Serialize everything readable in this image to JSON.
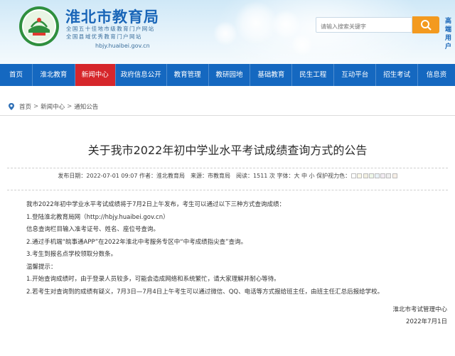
{
  "header": {
    "site_title": "淮北市教育局",
    "sub1": "全国五十佳地市级教育门户网站",
    "sub2": "全国县域优秀教育门户网站",
    "url": "hbjy.huaibei.gov.cn",
    "search_placeholder": "请输入搜索关键字",
    "right_text_1": "高端",
    "right_text_2": "用户"
  },
  "nav": {
    "items": [
      {
        "label": "首页"
      },
      {
        "label": "淮北教育"
      },
      {
        "label": "新闻中心"
      },
      {
        "label": "政府信息公开"
      },
      {
        "label": "教育管理"
      },
      {
        "label": "教研园地"
      },
      {
        "label": "基础教育"
      },
      {
        "label": "民生工程"
      },
      {
        "label": "互动平台"
      },
      {
        "label": "招生考试"
      },
      {
        "label": "信息资"
      }
    ]
  },
  "breadcrumb": {
    "items": [
      "首页",
      "新闻中心",
      "通知公告"
    ],
    "sep": ">"
  },
  "article": {
    "title": "关于我市2022年初中学业水平考试成绩查询方式的公告",
    "meta": "发布日期：2022-07-01 09:07 作者：淮北教育局　来源：市教育局　阅读：1511 次 字体：大 中 小 保护视力色：",
    "paragraphs": [
      "我市2022年初中学业水平考试成绩将于7月2日上午发布，考生可以通过以下三种方式查询成绩：",
      "1.登陆淮北教育局网（http://hbjy.huaibei.gov.cn）",
      "信息查询栏目输入准考证号、姓名、座位号查询。",
      "2.通过手机端“皖事通APP”在2022年淮北中考服务专区中“中考成绩指尖查”查询。",
      "3.考生到报名点学校领取分数条。",
      "温馨提示：",
      "1.开始查询成绩时，由于登录人员较多，可能会造成网络和系统繁忙，请大家理解并耐心等待。",
      "2.若考生对查询到的成绩有疑义，7月3日—7月4日上午考生可以通过微信、QQ、电话等方式报给班主任，由班主任汇总后报给学校。"
    ],
    "signature_org": "淮北市考试管理中心",
    "signature_date": "2022年7月1日"
  },
  "colors": {
    "nav_bg": "#1568c0",
    "nav_active": "#d6262b",
    "title_blue": "#1a66b8",
    "search_button": "#f39a1f"
  }
}
